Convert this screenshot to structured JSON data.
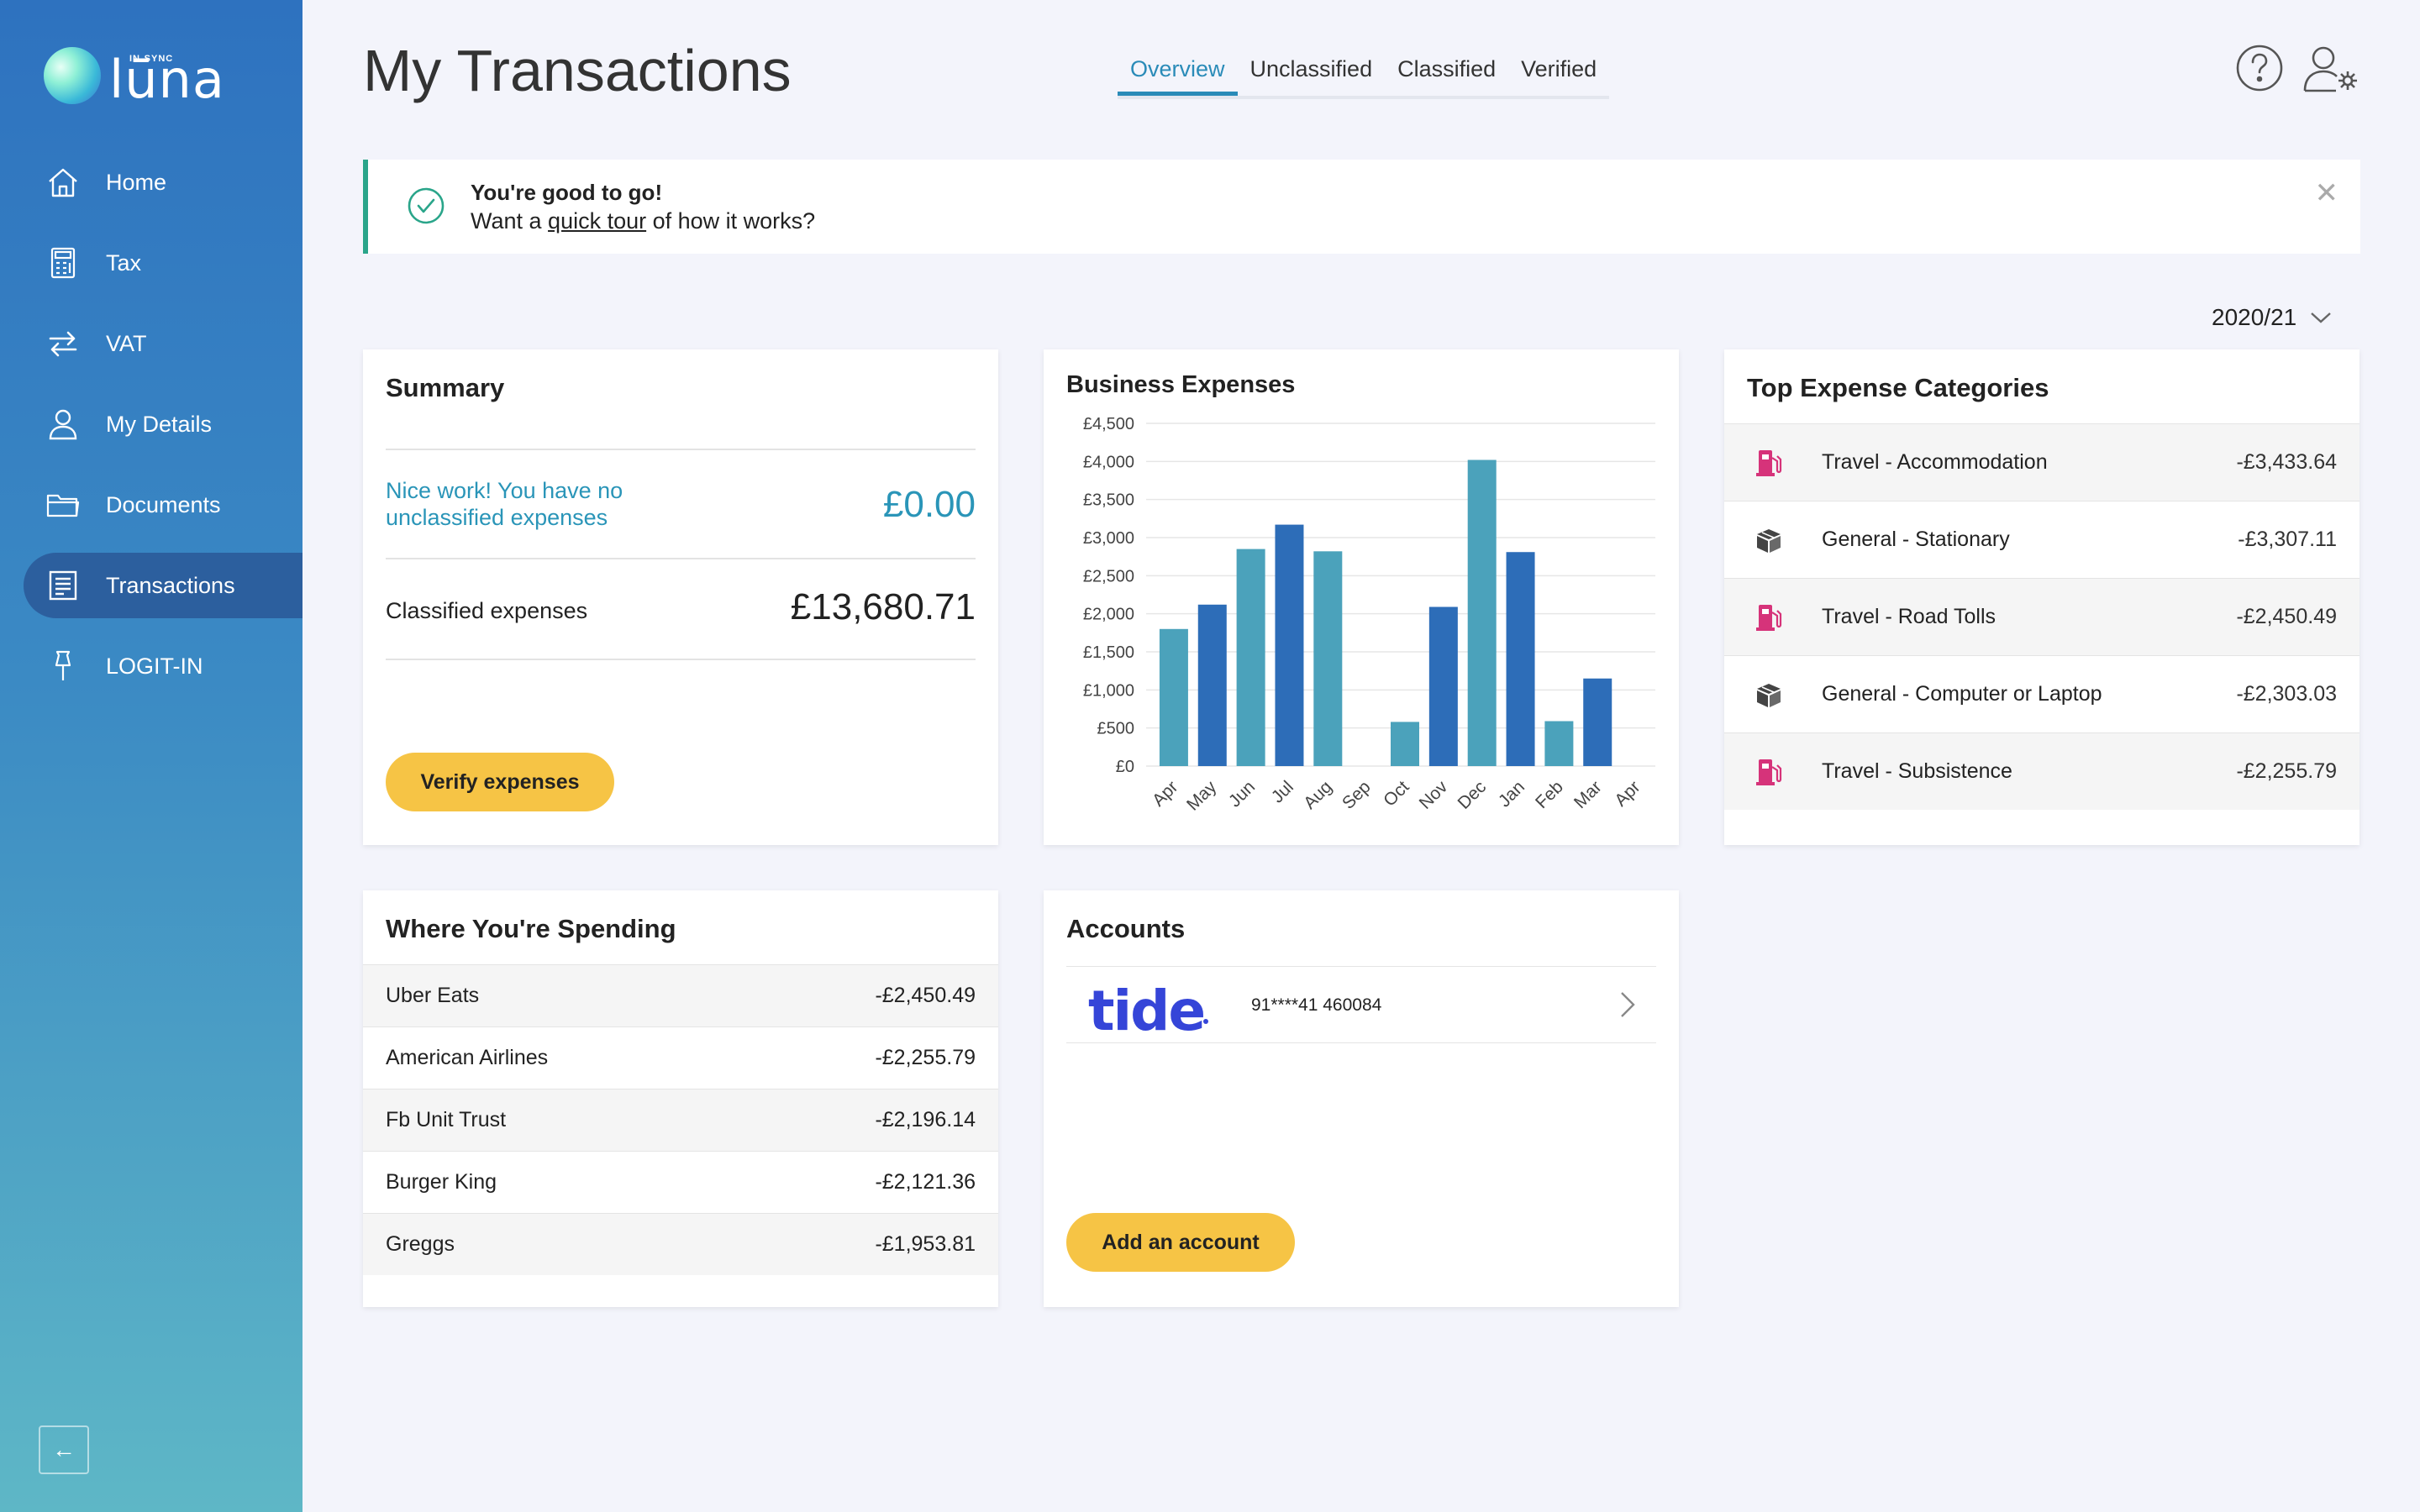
{
  "brand": {
    "small": "IN-SYNC",
    "name": "lūna"
  },
  "sidebar": {
    "items": [
      {
        "label": "Home",
        "icon": "home-icon"
      },
      {
        "label": "Tax",
        "icon": "calculator-icon"
      },
      {
        "label": "VAT",
        "icon": "swap-arrows-icon"
      },
      {
        "label": "My Details",
        "icon": "person-icon"
      },
      {
        "label": "Documents",
        "icon": "folder-icon"
      },
      {
        "label": "Transactions",
        "icon": "receipt-icon",
        "active": true
      },
      {
        "label": "LOGIT-IN",
        "icon": "pin-icon"
      }
    ],
    "collapse_label": "←"
  },
  "header": {
    "title": "My Transactions",
    "tabs": [
      {
        "label": "Overview",
        "active": true
      },
      {
        "label": "Unclassified"
      },
      {
        "label": "Classified"
      },
      {
        "label": "Verified"
      }
    ]
  },
  "banner": {
    "title": "You're good to go!",
    "sub_before": "Want a ",
    "link": "quick tour",
    "sub_after": " of how it works?",
    "close": "✕"
  },
  "year": {
    "value": "2020/21"
  },
  "summary": {
    "title": "Summary",
    "nice": "Nice work! You have no unclassified expenses",
    "unclassified_value": "£0.00",
    "classified_label": "Classified expenses",
    "classified_value": "£13,680.71",
    "verify_label": "Verify expenses"
  },
  "chart_data": {
    "type": "bar",
    "title": "Business Expenses",
    "categories": [
      "Apr",
      "May",
      "Jun",
      "Jul",
      "Aug",
      "Sep",
      "Oct",
      "Nov",
      "Dec",
      "Jan",
      "Feb",
      "Mar",
      "Apr"
    ],
    "values": [
      1800,
      2120,
      2850,
      3170,
      2820,
      0,
      580,
      2090,
      4020,
      2810,
      590,
      1150,
      0
    ],
    "ylim": [
      0,
      4500
    ],
    "yticks": [
      "£0",
      "£500",
      "£1,000",
      "£1,500",
      "£2,000",
      "£2,500",
      "£3,000",
      "£3,500",
      "£4,000",
      "£4,500"
    ],
    "ytick_values": [
      0,
      500,
      1000,
      1500,
      2000,
      2500,
      3000,
      3500,
      4000,
      4500
    ],
    "colors": [
      "#4ba2bb",
      "#2d6db8"
    ],
    "grid": true
  },
  "top_categories": {
    "title": "Top Expense Categories",
    "items": [
      {
        "name": "Travel - Accommodation",
        "amount": "-£3,433.64",
        "icon": "fuel-pump-icon",
        "color": "#d6337a"
      },
      {
        "name": "General - Stationary",
        "amount": "-£3,307.11",
        "icon": "box-icon",
        "color": "#444444"
      },
      {
        "name": "Travel - Road Tolls",
        "amount": "-£2,450.49",
        "icon": "fuel-pump-icon",
        "color": "#d6337a"
      },
      {
        "name": "General - Computer or Laptop",
        "amount": "-£2,303.03",
        "icon": "box-icon",
        "color": "#444444"
      },
      {
        "name": "Travel - Subsistence",
        "amount": "-£2,255.79",
        "icon": "fuel-pump-icon",
        "color": "#d6337a"
      }
    ]
  },
  "spending": {
    "title": "Where You're Spending",
    "items": [
      {
        "name": "Uber Eats",
        "amount": "-£2,450.49"
      },
      {
        "name": "American Airlines",
        "amount": "-£2,255.79"
      },
      {
        "name": "Fb Unit Trust",
        "amount": "-£2,196.14"
      },
      {
        "name": "Burger King",
        "amount": "-£2,121.36"
      },
      {
        "name": "Greggs",
        "amount": "-£1,953.81"
      }
    ]
  },
  "accounts": {
    "title": "Accounts",
    "bank_logo": "tide",
    "account_number": "91****41 460084",
    "add_label": "Add an account"
  }
}
